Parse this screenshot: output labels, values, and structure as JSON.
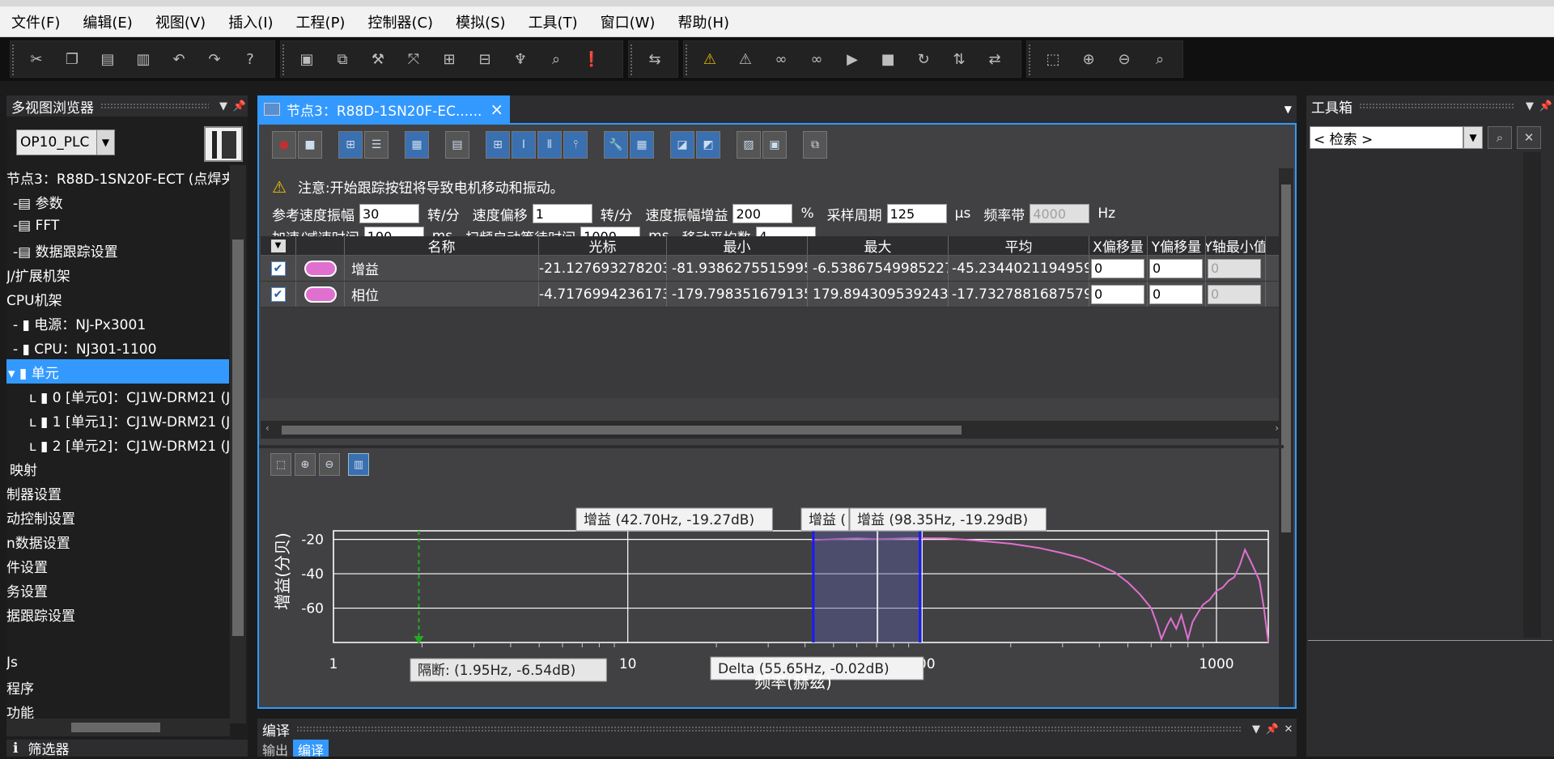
{
  "menu": [
    "文件(F)",
    "编辑(E)",
    "视图(V)",
    "插入(I)",
    "工程(P)",
    "控制器(C)",
    "模拟(S)",
    "工具(T)",
    "窗口(W)",
    "帮助(H)"
  ],
  "left": {
    "title": "多视图浏览器",
    "plc": "OP10_PLC",
    "tree": [
      "节点3：R88D-1SN20F-ECT (点焊夹",
      "-▤ 参数",
      "-▤ FFT",
      "-▤ 数据跟踪设置",
      "J/扩展机架",
      "CPU机架",
      "- ▮ 电源：NJ-Px3001",
      "- ▮ CPU：NJ301-1100",
      "▾ ▮ 单元",
      "ʟ ▮ 0 [单元0]：CJ1W-DRM21 (J",
      "ʟ ▮ 1 [单元1]：CJ1W-DRM21 (J",
      "ʟ ▮ 2 [单元2]：CJ1W-DRM21 (J",
      "映射",
      "制器设置",
      "动控制设置",
      "n数据设置",
      "件设置",
      "务设置",
      "据跟踪设置",
      "",
      "Js",
      "程序",
      "功能"
    ],
    "filter": "筛选器"
  },
  "tab": {
    "label": "节点3：R88D-1SN20F-EC......",
    "close": "×"
  },
  "warning": "注意:开始跟踪按钮将导致电机移动和振动。",
  "params": {
    "ref_speed_amp_label": "参考速度振幅",
    "ref_speed_amp": "30",
    "rpm1": "转/分",
    "speed_offset_label": "速度偏移",
    "speed_offset": "1",
    "rpm2": "转/分",
    "gain_label": "速度振幅增益",
    "gain": "200",
    "pct": "%",
    "sample_label": "采样周期",
    "sample": "125",
    "us": "μs",
    "band_label": "频率带",
    "band": "4000",
    "hz": "Hz",
    "accel_label": "加速/减速时间",
    "accel": "100",
    "ms1": "ms",
    "wait_label": "扫频启动等待时间",
    "wait": "1000",
    "ms2": "ms",
    "avg_label": "移动平均数",
    "avg": "4"
  },
  "table": {
    "headers": [
      "名称",
      "光标",
      "最小",
      "最大",
      "平均",
      "X偏移量",
      "Y偏移量",
      "Y轴最小值"
    ],
    "rows": [
      {
        "name": "增益",
        "cursor": "-21.127693278203",
        "min": "-81.9386275515995",
        "max": "-6.53867549985227",
        "avg": "-45.2344021194959",
        "xoff": "0",
        "yoff": "0",
        "ymin": "0"
      },
      {
        "name": "相位",
        "cursor": "-4.71769942361732",
        "min": "-179.798351679135",
        "max": "179.894309539243",
        "avg": "-17.7327881687579",
        "xoff": "0",
        "yoff": "0",
        "ymin": "0"
      }
    ]
  },
  "chart_data": {
    "type": "line",
    "xlabel": "频率(赫兹)",
    "ylabel": "增益(分贝)",
    "xscale": "log",
    "xlim": [
      1,
      1500
    ],
    "ylim": [
      -80,
      -15
    ],
    "xticks": [
      "1",
      "10",
      "100",
      "1000"
    ],
    "yticks": [
      "-20",
      "-40",
      "-60"
    ],
    "series": [
      {
        "name": "增益",
        "color": "#e070d0",
        "points": [
          [
            42,
            -20.5
          ],
          [
            50,
            -19.8
          ],
          [
            60,
            -19.3
          ],
          [
            70,
            -19.8
          ],
          [
            80,
            -19.6
          ],
          [
            90,
            -19.2
          ],
          [
            120,
            -19.4
          ],
          [
            150,
            -20.5
          ],
          [
            200,
            -22.5
          ],
          [
            250,
            -25
          ],
          [
            300,
            -28
          ],
          [
            350,
            -31
          ],
          [
            400,
            -35
          ],
          [
            450,
            -39
          ],
          [
            500,
            -45
          ],
          [
            550,
            -52
          ],
          [
            600,
            -60
          ],
          [
            630,
            -70
          ],
          [
            650,
            -78
          ],
          [
            680,
            -70
          ],
          [
            700,
            -66
          ],
          [
            730,
            -72
          ],
          [
            760,
            -64
          ],
          [
            800,
            -78
          ],
          [
            830,
            -68
          ],
          [
            870,
            -62
          ],
          [
            900,
            -58
          ],
          [
            950,
            -55
          ],
          [
            1000,
            -50
          ],
          [
            1050,
            -48
          ],
          [
            1100,
            -44
          ],
          [
            1150,
            -42
          ],
          [
            1200,
            -35
          ],
          [
            1250,
            -26
          ],
          [
            1300,
            -32
          ],
          [
            1350,
            -38
          ],
          [
            1400,
            -44
          ],
          [
            1450,
            -60
          ],
          [
            1500,
            -80
          ]
        ]
      }
    ],
    "annotations": {
      "cursor1": "增益 (42.70Hz, -19.27dB)",
      "cursor2_partial": "增益 (",
      "cursor3": "增益 (98.35Hz, -19.29dB)",
      "delta": "Delta (55.65Hz, -0.02dB)",
      "cutoff": "隔断:  (1.95Hz, -6.54dB)"
    }
  },
  "bottom": {
    "title": "编译",
    "tabs": [
      "输出",
      "编译"
    ]
  },
  "right": {
    "title": "工具箱",
    "search": "< 检索 >"
  },
  "colors": {
    "accent": "#3399ff",
    "curve": "#e070d0",
    "warning": "#f0c000"
  }
}
